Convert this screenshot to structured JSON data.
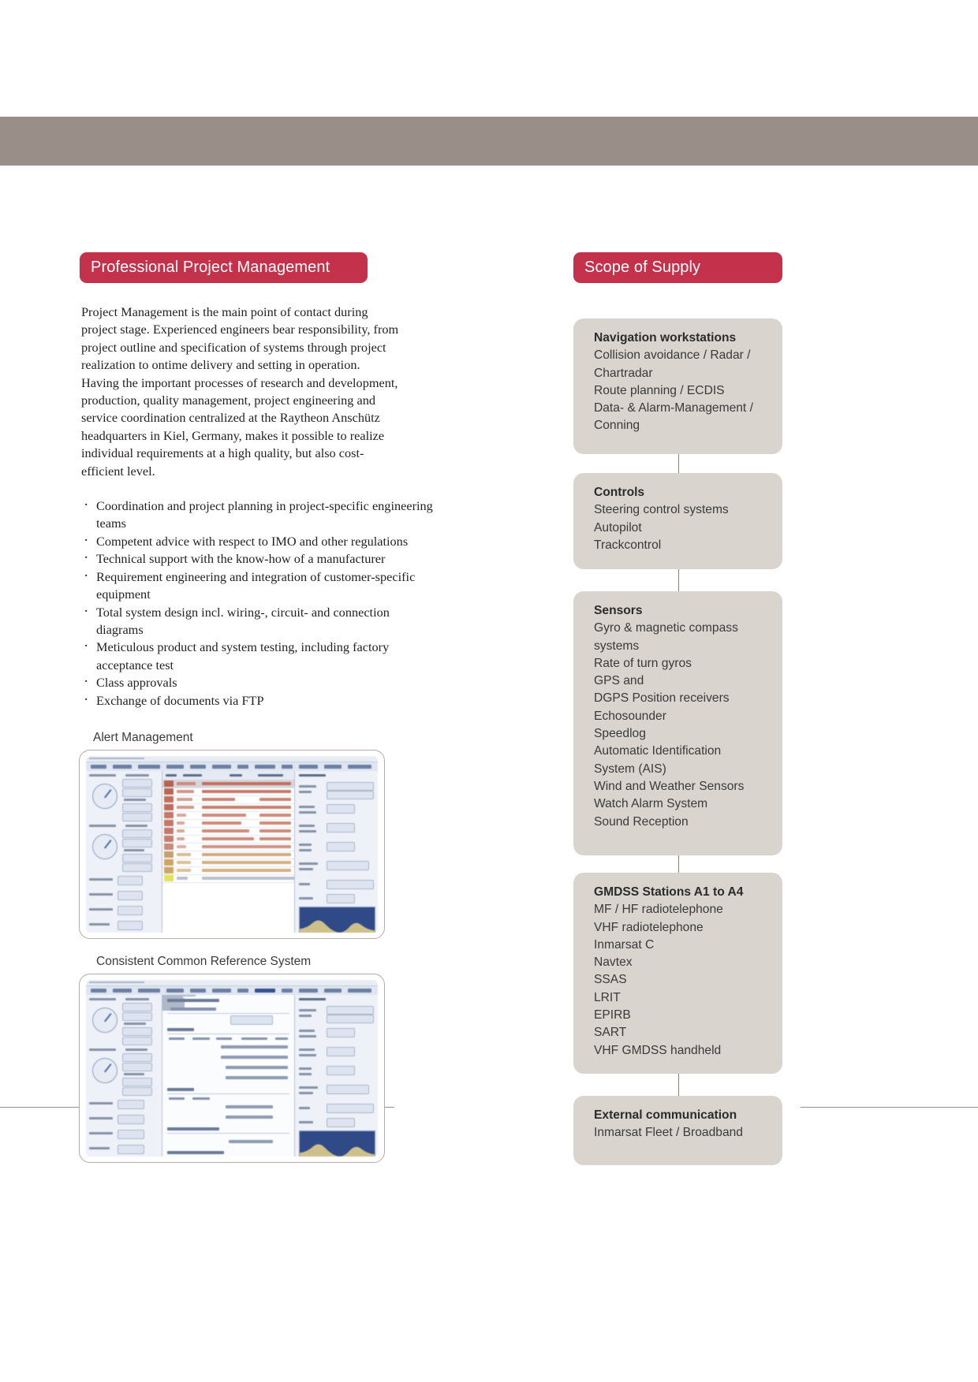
{
  "document": {
    "left_column": {
      "header": "Professional Project Management",
      "paragraph_lines": [
        "Project Management is the main point of contact during",
        "project stage. Experienced engineers bear responsibility, from",
        "project outline and specification of systems through project",
        "realization to ontime delivery and setting in operation.",
        "Having the important processes of research and development,",
        "production, quality management, project engineering and",
        "service coordination centralized at the Raytheon Anschütz",
        "headquarters in Kiel, Germany, makes it possible to realize",
        "individual requirements at a high quality, but also cost-",
        "efficient level."
      ],
      "bullets": [
        "Coordination and project planning in project-specific engineering teams",
        "Competent advice with respect to IMO and other regulations",
        "Technical support with the know-how of a manufacturer",
        "Requirement engineering and integration of customer-specific equipment",
        "Total system design incl. wiring-, circuit- and connection diagrams",
        "Meticulous product and system testing, including factory acceptance test",
        "Class approvals",
        "Exchange of documents via FTP"
      ],
      "screenshots": [
        {
          "caption": "Alert Management"
        },
        {
          "caption": "Consistent Common Reference System"
        }
      ]
    },
    "right_column": {
      "header": "Scope of Supply",
      "boxes": [
        {
          "title": "Navigation workstations",
          "lines": [
            "Collision avoidance / Radar /",
            "Chartradar",
            "Route planning / ECDIS",
            "Data- & Alarm-Management /",
            "Conning"
          ]
        },
        {
          "title": "Controls",
          "lines": [
            "Steering control systems",
            "Autopilot",
            "Trackcontrol"
          ]
        },
        {
          "title": "Sensors",
          "lines": [
            "Gyro & magnetic compass",
            "systems",
            "Rate of turn gyros",
            "GPS and",
            "DGPS Position receivers",
            "Echosounder",
            "Speedlog",
            "Automatic Identification",
            "System (AIS)",
            "Wind and Weather Sensors",
            "Watch Alarm System",
            "Sound Reception"
          ]
        },
        {
          "title": "GMDSS Stations A1 to A4",
          "lines": [
            "MF / HF radiotelephone",
            "VHF radiotelephone",
            "Inmarsat C",
            "Navtex",
            "SSAS",
            "LRIT",
            "EPIRB",
            "SART",
            "VHF GMDSS handheld"
          ]
        },
        {
          "title": "External communication",
          "lines": [
            "Inmarsat Fleet / Broadband"
          ]
        }
      ]
    },
    "colors": {
      "accent_red": "#c3314a",
      "banner_taupe": "#9a8e89",
      "box_grey": "#d9d4cd",
      "rule_brown": "#9b8f8a",
      "body_text": "#231f20"
    }
  }
}
